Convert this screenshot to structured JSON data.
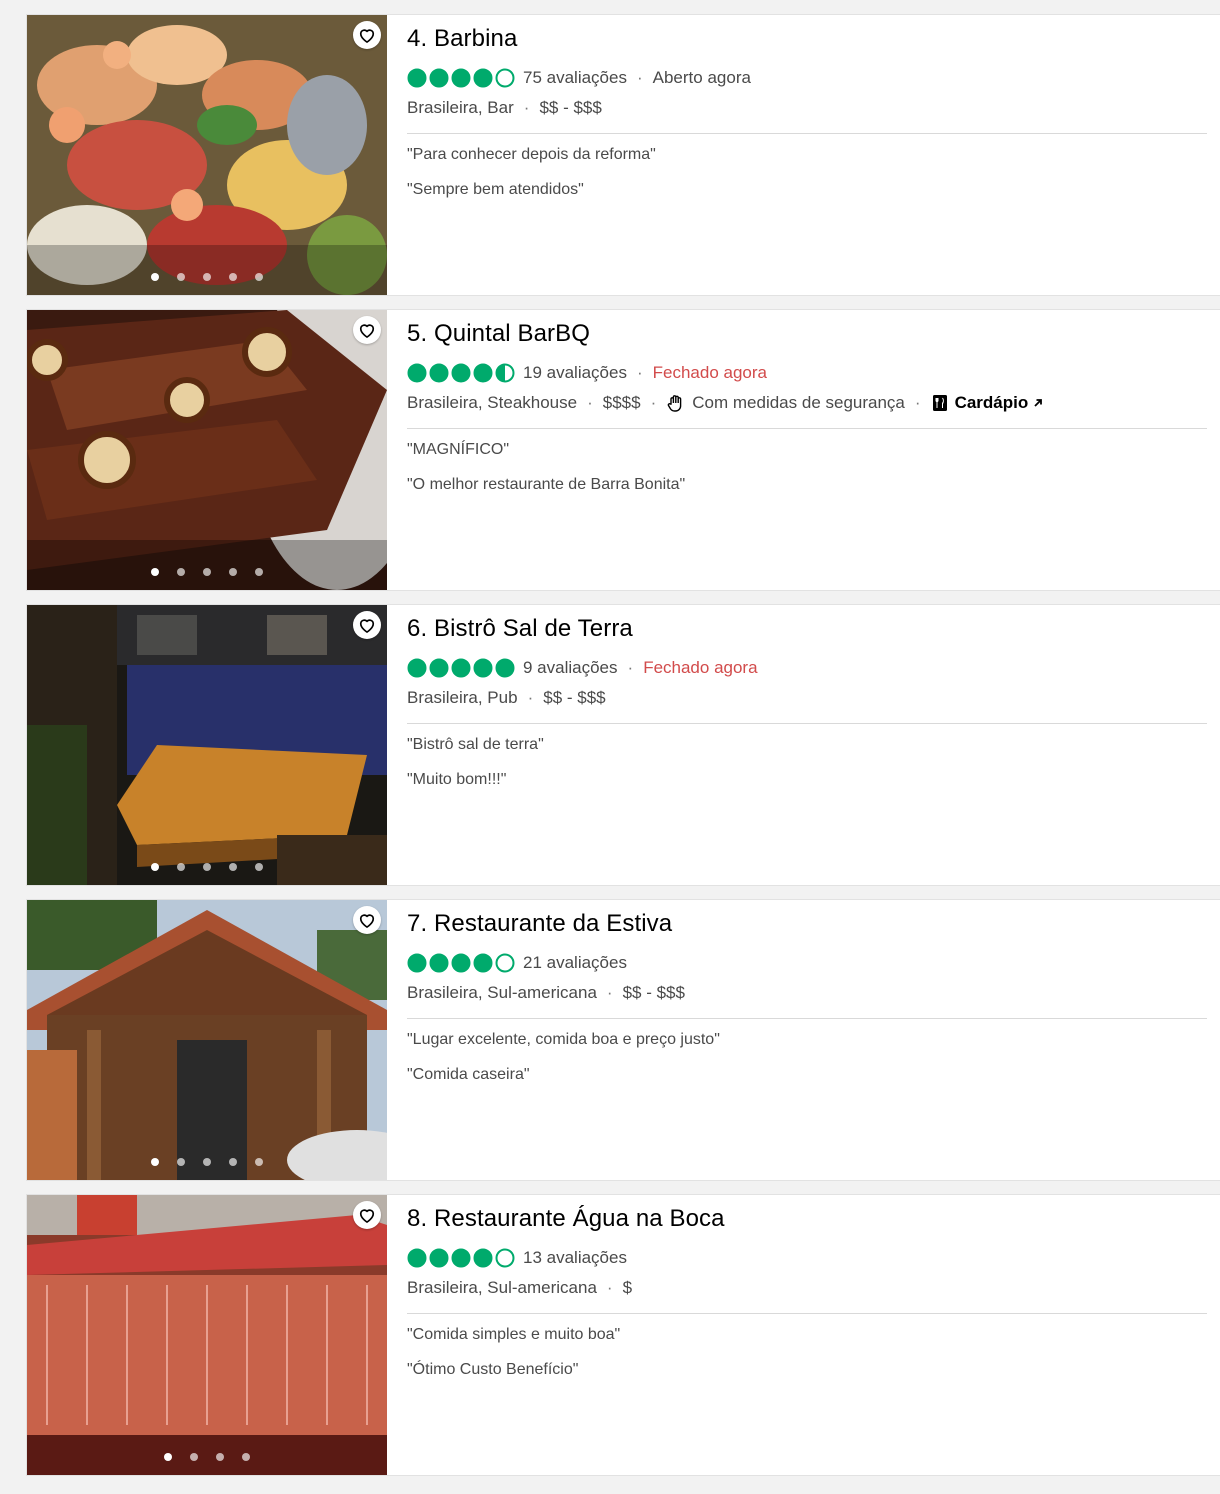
{
  "colors": {
    "rating_green": "#00aa6c",
    "closed_red": "#d24b4b",
    "text_gray": "#4a4a4a"
  },
  "restaurants": [
    {
      "title": "4. Barbina",
      "rating": 4,
      "reviews": "75 avaliações",
      "status": "Aberto agora",
      "status_closed": false,
      "cuisine": "Brasileira, Bar",
      "price": "$$ - $$$",
      "quote1": "\"Para conhecer depois da reforma\"",
      "quote2": "\"Sempre bem atendidos\"",
      "photo_dots": 5
    },
    {
      "title": "5. Quintal BarBQ",
      "rating": 4.5,
      "reviews": "19 avaliações",
      "status": "Fechado agora",
      "status_closed": true,
      "cuisine": "Brasileira, Steakhouse",
      "price": "$$$$",
      "safety": "Com medidas de segurança",
      "menu": "Cardápio",
      "quote1": "\"MAGNÍFICO\"",
      "quote2": "\"O melhor restaurante de Barra Bonita\"",
      "photo_dots": 5
    },
    {
      "title": "6. Bistrô Sal de Terra",
      "rating": 5,
      "reviews": "9 avaliações",
      "status": "Fechado agora",
      "status_closed": true,
      "cuisine": "Brasileira, Pub",
      "price": "$$ - $$$",
      "quote1": "\"Bistrô sal de terra\"",
      "quote2": "\"Muito bom!!!\"",
      "photo_dots": 5
    },
    {
      "title": "7. Restaurante da Estiva",
      "rating": 4,
      "reviews": "21 avaliações",
      "cuisine": "Brasileira, Sul-americana",
      "price": "$$ - $$$",
      "quote1": "\"Lugar excelente, comida boa e preço justo\"",
      "quote2": "\"Comida caseira\"",
      "photo_dots": 5
    },
    {
      "title": "8. Restaurante Água na Boca",
      "rating": 4,
      "reviews": "13 avaliações",
      "cuisine": "Brasileira, Sul-americana",
      "price": "$",
      "quote1": "\"Comida simples e muito boa\"",
      "quote2": "\"Ótimo Custo Benefício\"",
      "photo_dots": 4
    }
  ]
}
